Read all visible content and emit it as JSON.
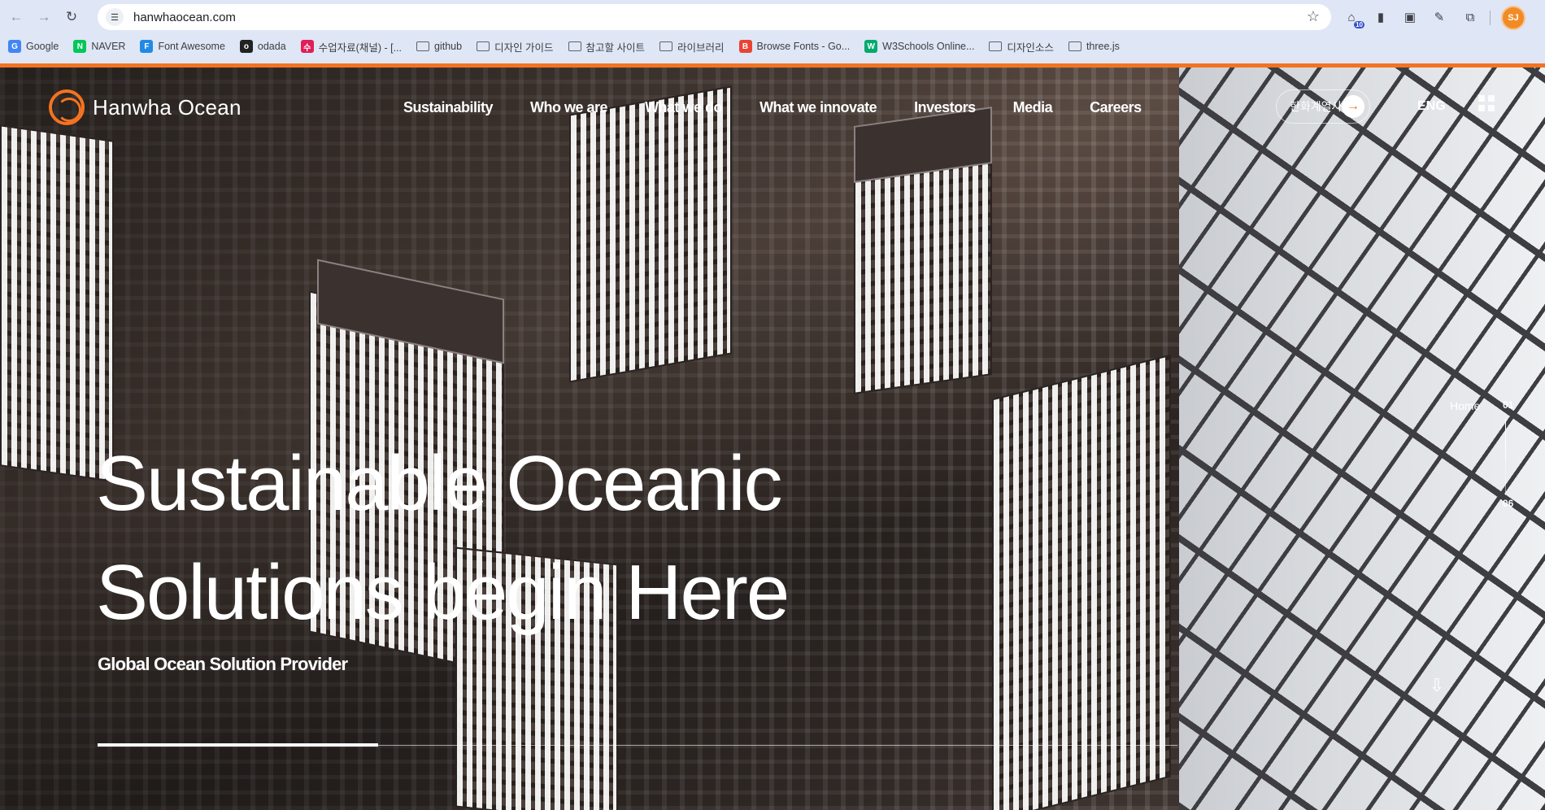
{
  "browser": {
    "url": "hanwhaocean.com",
    "icons": {
      "back": "arrow-left-icon",
      "forward": "arrow-right-icon",
      "reload": "reload-icon",
      "site_info": "tune-icon",
      "bookmark_star": "star-icon"
    },
    "extensions": [
      {
        "name": "extension-badge-icon",
        "badge": "10"
      },
      {
        "name": "extension-sidebar-icon"
      },
      {
        "name": "extension-monitor-icon"
      },
      {
        "name": "extension-picker-icon"
      },
      {
        "name": "extensions-puzzle-icon"
      }
    ],
    "profile_initials": "SJ",
    "bookmarks": [
      {
        "label": "Google",
        "icon": "google-icon",
        "color": "#4285f4"
      },
      {
        "label": "NAVER",
        "icon": "naver-icon",
        "color": "#03c75a"
      },
      {
        "label": "Font Awesome",
        "icon": "font-awesome-icon",
        "color": "#228ae6"
      },
      {
        "label": "odada",
        "icon": "odada-icon",
        "color": "#222222"
      },
      {
        "label": "수업자료(채널) - [...",
        "icon": "slack-icon",
        "color": "#e01e5a"
      },
      {
        "label": "github",
        "icon": "folder-icon"
      },
      {
        "label": "디자인 가이드",
        "icon": "folder-icon"
      },
      {
        "label": "참고할 사이트",
        "icon": "folder-icon"
      },
      {
        "label": "라이브러리",
        "icon": "folder-icon"
      },
      {
        "label": "Browse Fonts - Go...",
        "icon": "google-fonts-icon",
        "color": "#ea4335"
      },
      {
        "label": "W3Schools Online...",
        "icon": "w3schools-icon",
        "color": "#04aa6d"
      },
      {
        "label": "디자인소스",
        "icon": "folder-icon"
      },
      {
        "label": "three.js",
        "icon": "folder-icon"
      }
    ]
  },
  "site": {
    "brand": "Hanwha Ocean",
    "accent": "#f37321",
    "nav": [
      "Sustainability",
      "Who we are",
      "What we do",
      "What we innovate",
      "Investors",
      "Media",
      "Careers"
    ],
    "affiliate_label": "한화계열사",
    "lang": "ENG",
    "hero": {
      "title_line1": "Sustainable Oceanic",
      "title_line2": "Solutions begin Here",
      "subtitle": "Global Ocean Solution Provider",
      "progress": 0.26
    },
    "pagination": {
      "section_label": "Home",
      "current": "01",
      "total": "06",
      "progress": 0.55
    }
  }
}
